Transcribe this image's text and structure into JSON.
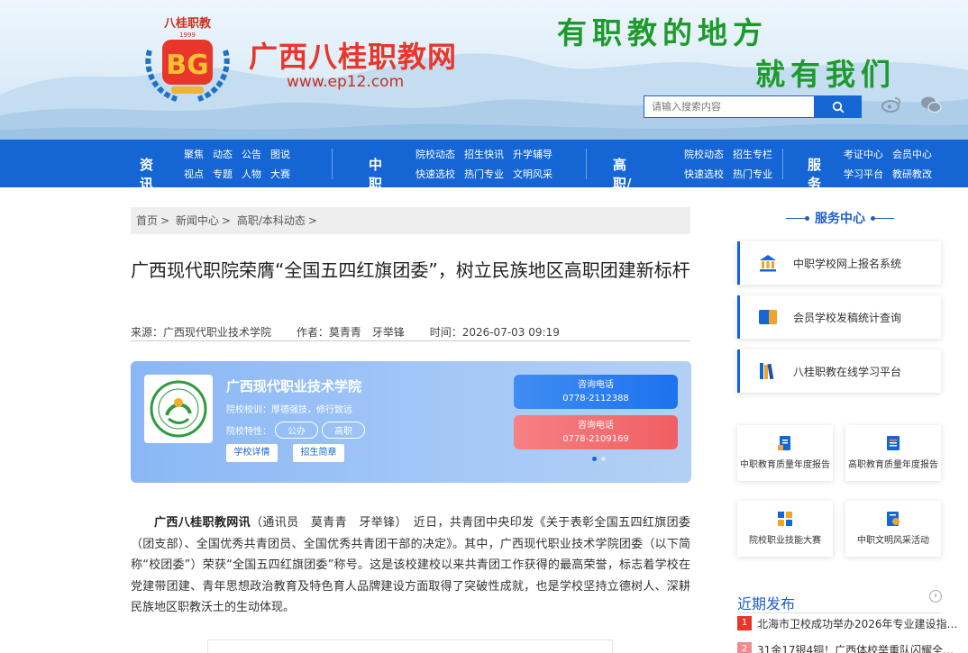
{
  "header": {
    "logo_arc_text": "八桂职教",
    "logo_year": "1999",
    "site_name": "广西八桂职教网",
    "site_url": "www.ep12.com",
    "slogan_line1": "有职教的地方",
    "slogan_line2": "就有我们",
    "search_placeholder": "请输入搜索内容",
    "icons": [
      "weibo-icon",
      "wechat-icon",
      "search-icon"
    ]
  },
  "nav": {
    "groups": [
      {
        "title": "资讯",
        "links": [
          "聚焦",
          "视点",
          "动态",
          "专题",
          "公告",
          "人物",
          "图说",
          "大赛"
        ]
      },
      {
        "title": "中职",
        "links": [
          "院校动态",
          "快速选校",
          "招生快讯",
          "热门专业",
          "升学辅导",
          "文明风采"
        ]
      },
      {
        "title": "高职/本科",
        "links": [
          "院校动态",
          "快速选校",
          "招生专栏",
          "热门专业"
        ]
      },
      {
        "title": "服务",
        "links": [
          "考证中心",
          "学习平台",
          "会员中心",
          "教研教改"
        ]
      }
    ]
  },
  "breadcrumb": [
    "首页",
    ">",
    "新闻中心",
    ">",
    "高职/本科动态",
    ">"
  ],
  "article": {
    "title": "广西现代职院荣膺“全国五四红旗团委”，树立民族地区高职团建新标杆",
    "source": "来源：广西现代职业技术学院",
    "author": "作者：莫青青　牙举锋",
    "time": "时间：2026-07-03 09:19",
    "lead": "广西八桂职教网讯",
    "body": "（通讯员　莫青青　牙举锋）　近日，共青团中央印发《关于表彰全国五四红旗团委（团支部）、全国优秀共青团员、全国优秀共青团干部的决定》。其中，广西现代职业技术学院团委（以下简称“校团委”）荣获“全国五四红旗团委”称号。这是该校建校以来共青团工作获得的最高荣誉，标志着学校在党建带团建、青年思想政治教育及特色育人品牌建设方面取得了突破性成就，也是学校坚持立德树人、深耕民族地区职教沃土的生动体现。"
  },
  "school_card": {
    "name": "广西现代职业技术学院",
    "motto": "院校校训：厚德强技，修行致远",
    "feature_label": "院校特性：",
    "tags": [
      "公办",
      "高职"
    ],
    "detail_button": "学校详情",
    "brochure_button": "招生简章",
    "phones": [
      {
        "label": "咨询电话",
        "number": "0778-2112388"
      },
      {
        "label": "咨询电话",
        "number": "0778-2109169"
      }
    ],
    "carousel_dots": 2,
    "active_dot": 0
  },
  "sidebar": {
    "service_title": "服务中心",
    "service_items": [
      "中职学校网上报名系统",
      "会员学校发稿统计查询",
      "八桂职教在线学习平台"
    ],
    "grid_items": [
      "中职教育质量年度报告",
      "高职教育质量年度报告",
      "院校职业技能大赛",
      "中职文明风采活动"
    ],
    "recent_title": "近期发布",
    "recent_more": "›",
    "recent_items": [
      {
        "rank": "1",
        "text": "北海市卫校成功举办2026年专业建设指…"
      },
      {
        "rank": "2",
        "text": "31金17银4铜！广西体校举重队闪耀全…"
      }
    ],
    "rank_colors": {
      "1": "#e8362a",
      "2": "#f08a8c"
    }
  },
  "colors": {
    "brand_blue": "#1566d4",
    "brand_red": "#e8362a",
    "slogan_green": "#1e9a2c"
  }
}
